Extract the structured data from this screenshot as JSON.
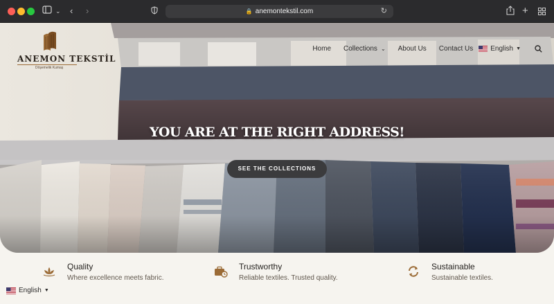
{
  "browser": {
    "url": "anemontekstil.com",
    "sidebar_icon": "sidebar-icon",
    "back_icon": "back-chevron",
    "forward_icon": "forward-chevron",
    "share_icon": "share-icon",
    "new_tab_icon": "plus-icon",
    "tabs_icon": "grid-icon"
  },
  "brand": {
    "name": "ANEMON TEKSTİL",
    "tagline": "Döşemelik Kumaş",
    "accent": "#9b6b36"
  },
  "nav": {
    "items": [
      {
        "label": "Home"
      },
      {
        "label": "Collections"
      },
      {
        "label": "About Us"
      },
      {
        "label": "Contact Us"
      }
    ],
    "language": "English"
  },
  "hero": {
    "title": "YOU ARE AT THE RIGHT ADDRESS!",
    "button_label": "SEE THE COLLECTIONS"
  },
  "features": [
    {
      "title": "Quality",
      "subtitle": "Where excellence meets fabric.",
      "icon": "lotus-icon"
    },
    {
      "title": "Trustworthy",
      "subtitle": "Reliable textiles. Trusted quality.",
      "icon": "briefcase-clock-icon"
    },
    {
      "title": "Sustainable",
      "subtitle": "Sustainable textiles.",
      "icon": "recycle-icon"
    }
  ],
  "footer": {
    "language": "English"
  },
  "colors": {
    "chrome": "#2b2b2d",
    "button": "#3b3b3d",
    "page_bg": "#f6f4ef",
    "accent": "#9b6b36"
  }
}
